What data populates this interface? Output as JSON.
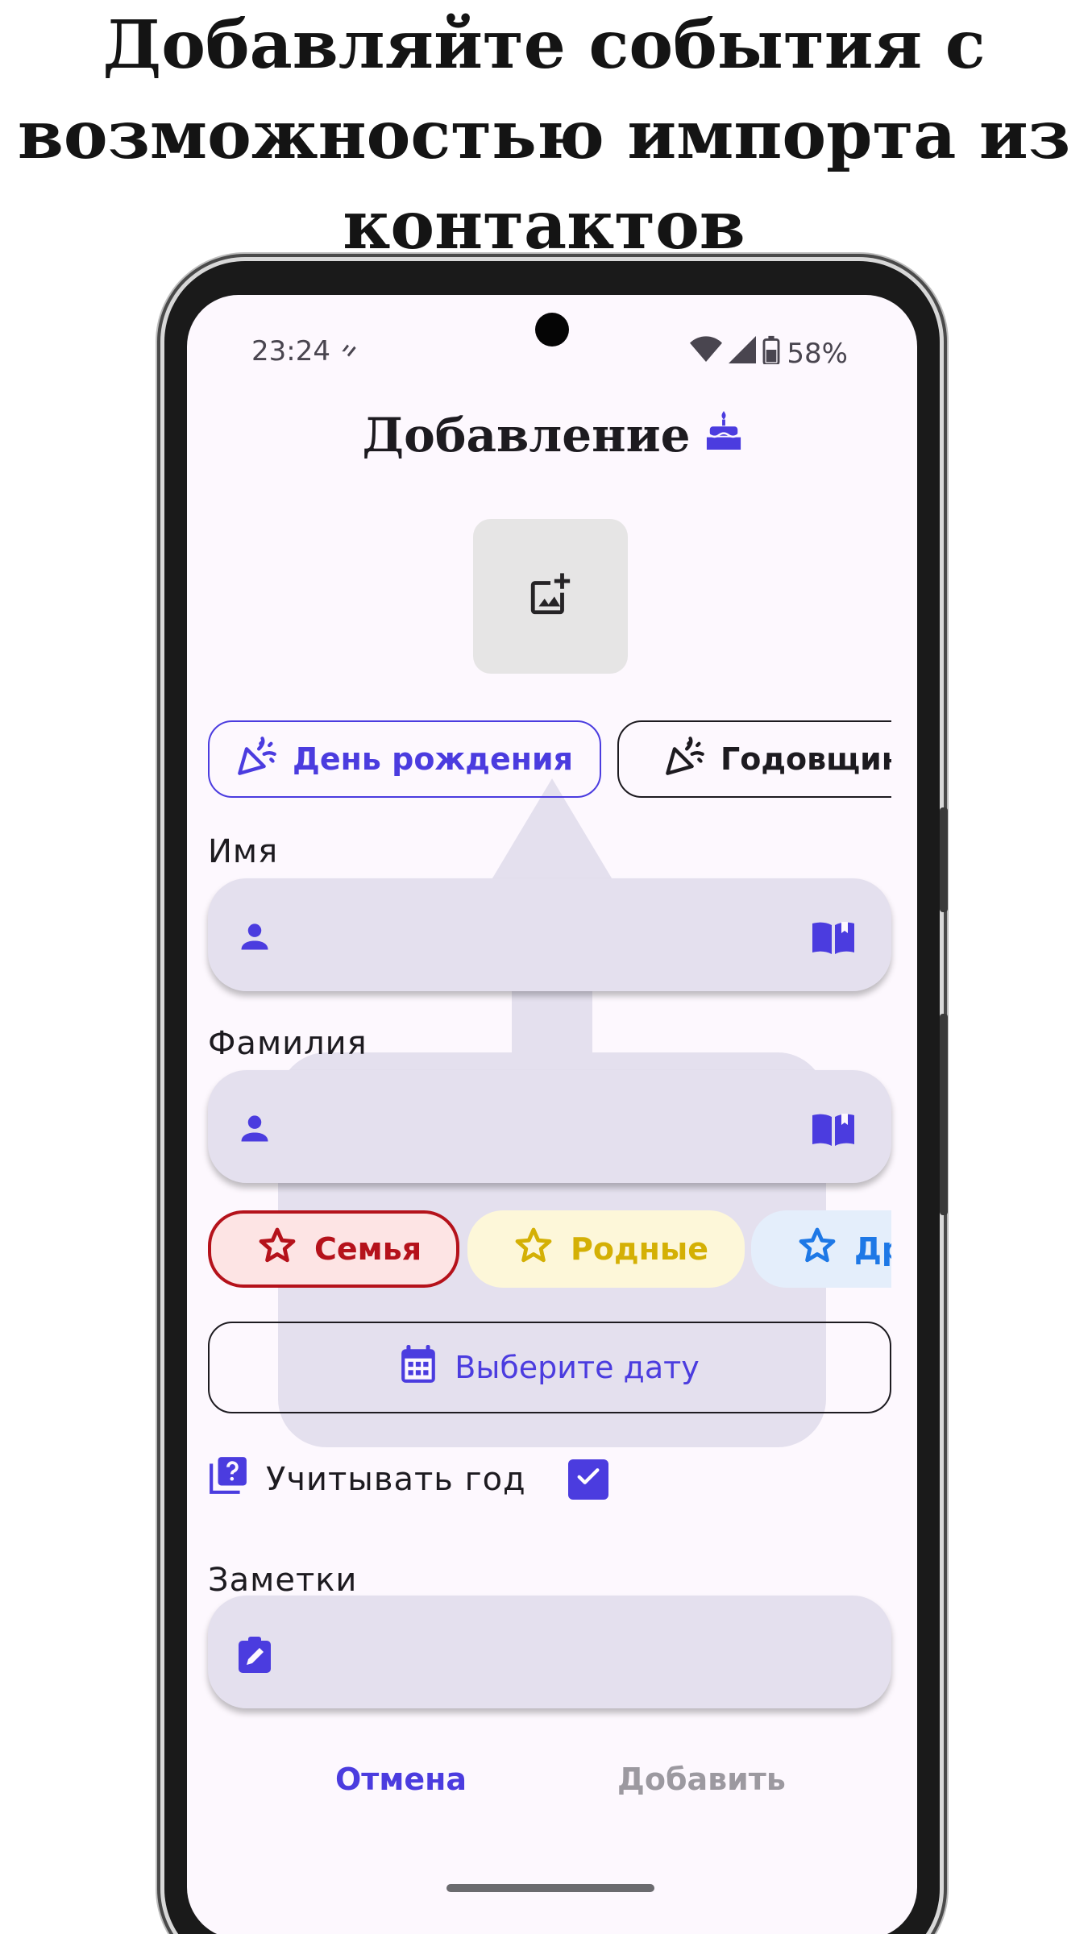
{
  "headline": {
    "line1": "Добавляйте события с",
    "line2": "возможностью импорта из",
    "line3": "контактов"
  },
  "status_bar": {
    "time": "23:24",
    "battery": "58%"
  },
  "screen": {
    "title": "Добавление",
    "event_types": [
      {
        "label": "День рождения",
        "selected": true
      },
      {
        "label": "Годовщина",
        "selected": false
      }
    ],
    "first_name": {
      "label": "Имя",
      "value": ""
    },
    "last_name": {
      "label": "Фамилия",
      "value": ""
    },
    "groups": [
      {
        "label": "Семья",
        "color": "#b5121b",
        "selected": true
      },
      {
        "label": "Родные",
        "color": "#d4b005",
        "selected": false
      },
      {
        "label": "Др",
        "color": "#1e78e6",
        "selected": false
      }
    ],
    "date_button": "Выберите дату",
    "consider_year": {
      "label": "Учитывать год",
      "checked": true
    },
    "notes": {
      "label": "Заметки",
      "value": ""
    },
    "cancel": "Отмена",
    "add": "Добавить"
  },
  "colors": {
    "accent": "#4b3cdf",
    "screen_bg": "#fdf8fe",
    "field_bg": "#e4e0ee"
  }
}
